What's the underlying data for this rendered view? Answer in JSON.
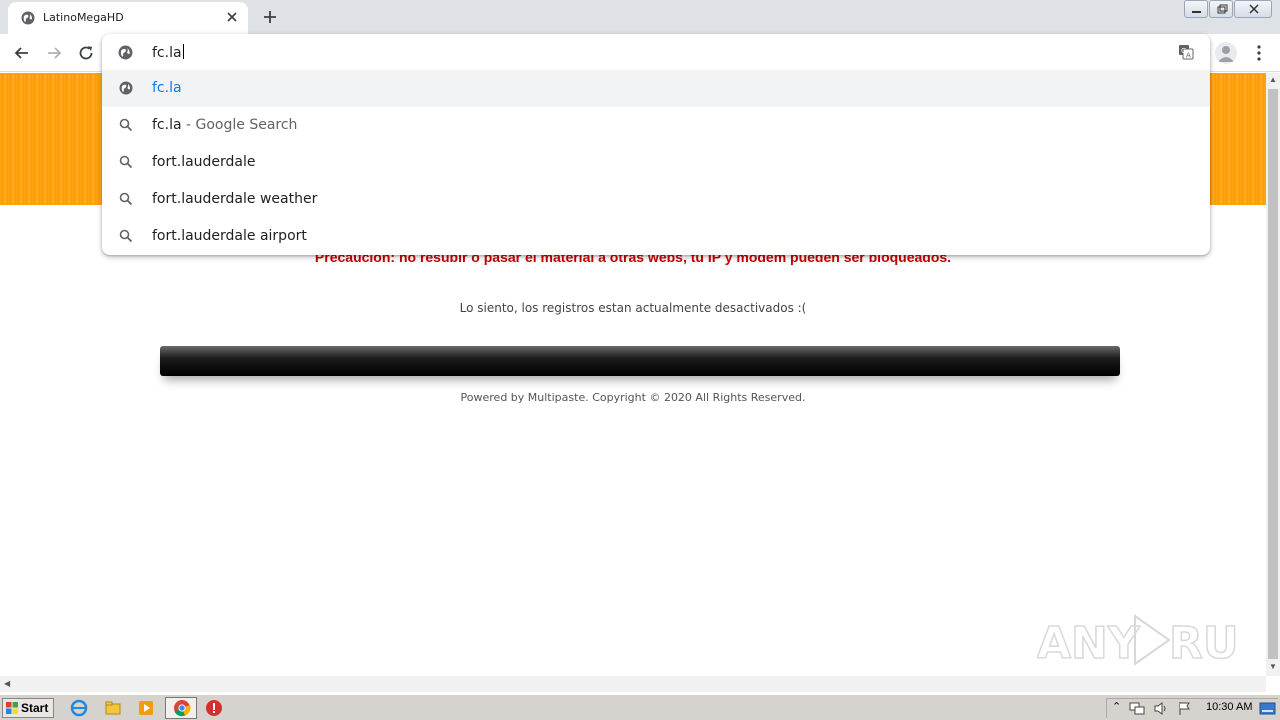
{
  "browser": {
    "tab": {
      "title": "LatinoMegaHD"
    },
    "omnibox": {
      "input": "fc.la",
      "suggestions": [
        {
          "text": "fc.la",
          "suffix": "",
          "icon": "globe-icon",
          "highlighted": true
        },
        {
          "text": "fc.la",
          "suffix": " - Google Search",
          "icon": "search-icon",
          "highlighted": false
        },
        {
          "text": "fort.lauderdale",
          "suffix": "",
          "icon": "search-icon",
          "highlighted": false
        },
        {
          "text": "fort.lauderdale weather",
          "suffix": "",
          "icon": "search-icon",
          "highlighted": false
        },
        {
          "text": "fort.lauderdale airport",
          "suffix": "",
          "icon": "search-icon",
          "highlighted": false
        }
      ]
    }
  },
  "page": {
    "warning": "Precaucion: no resubir o pasar el material a otras webs, tu IP y modem pueden ser bloqueados.",
    "notice": "Lo siento, los registros estan actualmente desactivados :(",
    "footer": "Powered by Multipaste. Copyright © 2020 All Rights Reserved.",
    "header_color": "#ff9e0b",
    "warning_color": "#cc0000"
  },
  "watermark": {
    "text": "ANY RUN"
  },
  "taskbar": {
    "start_label": "Start",
    "clock": "10:30 AM"
  }
}
